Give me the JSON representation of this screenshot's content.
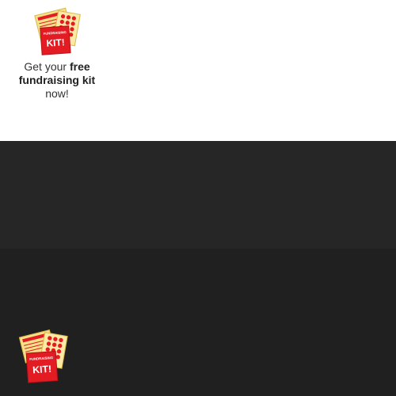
{
  "promo": {
    "icon": "fundraising-kit-icon",
    "kit_small_label": "FUNDRAISING",
    "kit_big_label": "KIT!",
    "text_before": "Get your ",
    "text_bold": "free fundraising kit",
    "text_after": "now!"
  },
  "footer_promo": {
    "icon": "fundraising-kit-icon",
    "kit_small_label": "FUNDRAISING",
    "kit_big_label": "KIT!"
  },
  "colors": {
    "kit_red": "#e31b23",
    "kit_yellow": "#f7e08a",
    "band_mid": "#262626",
    "band_bottom": "#202020"
  }
}
